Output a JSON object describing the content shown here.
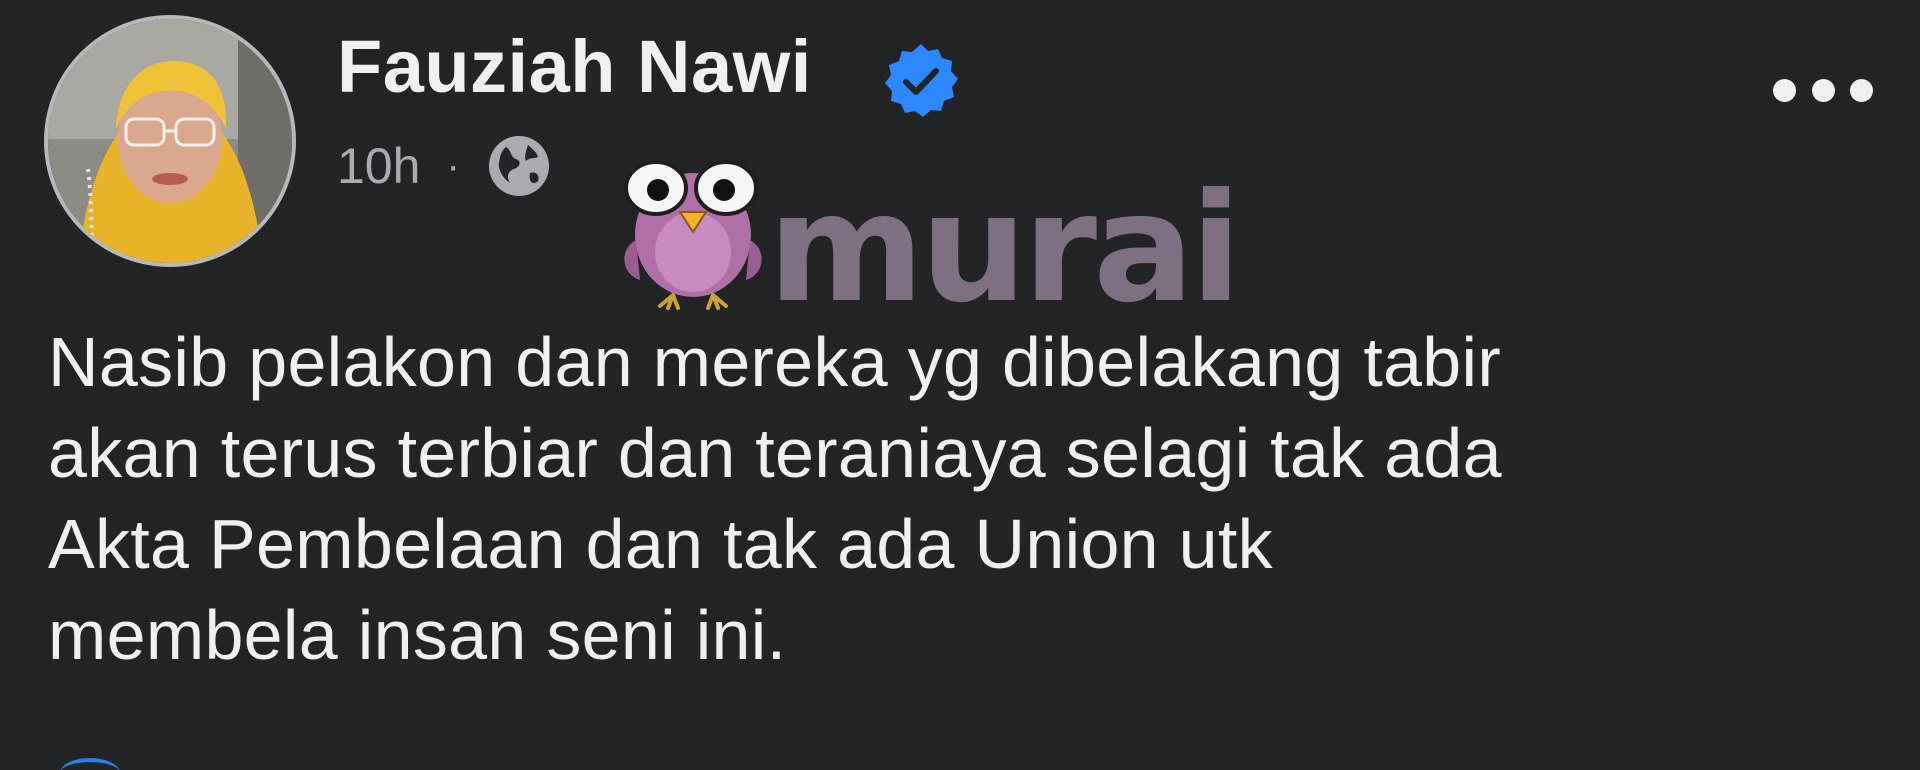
{
  "post": {
    "author": {
      "name": "Fauziah Nawi",
      "verified": true,
      "avatar_icon": "profile-photo"
    },
    "meta": {
      "time": "10h",
      "separator": "·",
      "audience_icon": "globe-icon"
    },
    "more_icon": "more-options-icon",
    "watermark": {
      "text": "murai",
      "icon": "owl-mascot"
    },
    "body_lines": [
      "Nasib pelakon dan mereka yg dibelakang tabir",
      "akan terus terbiar dan teraniaya selagi tak ada",
      "Akta Pembelaan dan tak ada Union utk",
      "membela insan seni ini."
    ]
  },
  "colors": {
    "background": "#232426",
    "text_primary": "#eef0f2",
    "text_secondary": "#a9abaf",
    "verified_blue": "#2d88ff",
    "watermark_purple": "#8e7e93",
    "mascot_pink": "#b06fa6"
  }
}
